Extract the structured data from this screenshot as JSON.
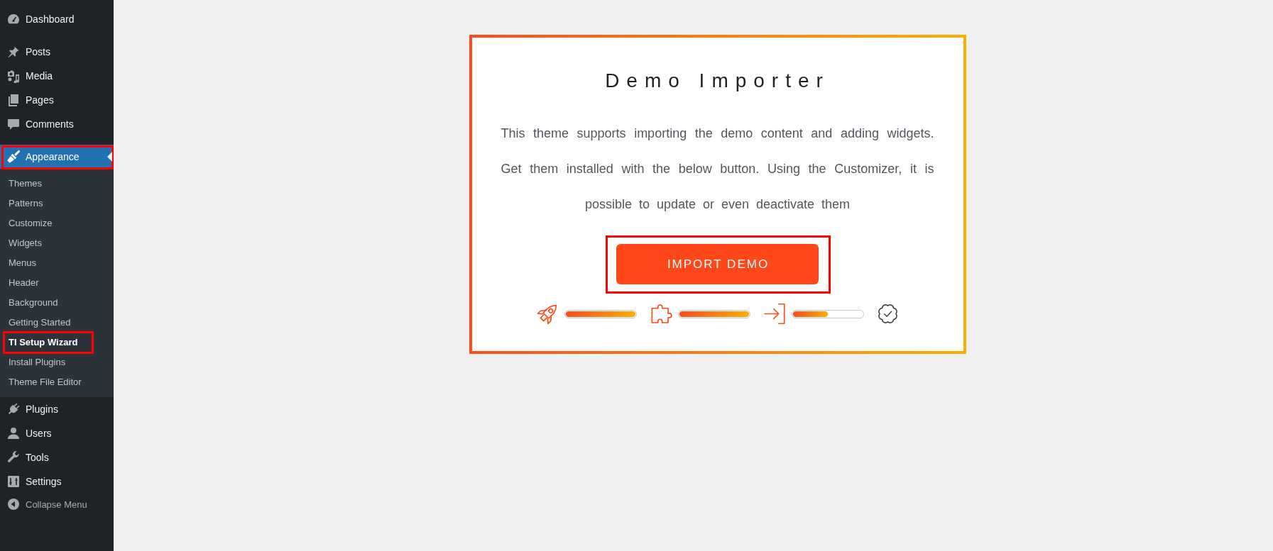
{
  "sidebar": {
    "groups": [
      {
        "items": [
          {
            "label": "Dashboard",
            "selected": false,
            "highlighted": false
          }
        ]
      },
      {
        "items": [
          {
            "label": "Posts",
            "selected": false,
            "highlighted": false
          },
          {
            "label": "Media",
            "selected": false,
            "highlighted": false
          },
          {
            "label": "Pages",
            "selected": false,
            "highlighted": false
          },
          {
            "label": "Comments",
            "selected": false,
            "highlighted": false
          }
        ]
      },
      {
        "items": [
          {
            "label": "Appearance",
            "selected": true,
            "highlighted": true,
            "children": [
              {
                "label": "Themes",
                "selected": false,
                "highlighted": false
              },
              {
                "label": "Patterns",
                "selected": false,
                "highlighted": false
              },
              {
                "label": "Customize",
                "selected": false,
                "highlighted": false
              },
              {
                "label": "Widgets",
                "selected": false,
                "highlighted": false
              },
              {
                "label": "Menus",
                "selected": false,
                "highlighted": false
              },
              {
                "label": "Header",
                "selected": false,
                "highlighted": false
              },
              {
                "label": "Background",
                "selected": false,
                "highlighted": false
              },
              {
                "label": "Getting Started",
                "selected": false,
                "highlighted": false
              },
              {
                "label": "TI Setup Wizard",
                "selected": true,
                "highlighted": true
              },
              {
                "label": "Install Plugins",
                "selected": false,
                "highlighted": false
              },
              {
                "label": "Theme File Editor",
                "selected": false,
                "highlighted": false
              }
            ]
          },
          {
            "label": "Plugins",
            "selected": false,
            "highlighted": false
          },
          {
            "label": "Users",
            "selected": false,
            "highlighted": false
          },
          {
            "label": "Tools",
            "selected": false,
            "highlighted": false
          },
          {
            "label": "Settings",
            "selected": false,
            "highlighted": false
          }
        ]
      }
    ],
    "collapse_menu": {
      "label": "Collapse Menu"
    }
  },
  "importer": {
    "title": "Demo Importer",
    "description": "This theme supports importing the demo content and adding widgets. Get them installed with the below button. Using the Customizer, it is possible to update or even deactivate them",
    "button": {
      "label": "IMPORT DEMO",
      "highlighted": true
    },
    "steps": [
      {
        "reached": true,
        "level": 1
      },
      {
        "reached": true,
        "level": 1
      },
      {
        "reached": true,
        "level": 0.5
      },
      {
        "reached": false
      }
    ]
  }
}
